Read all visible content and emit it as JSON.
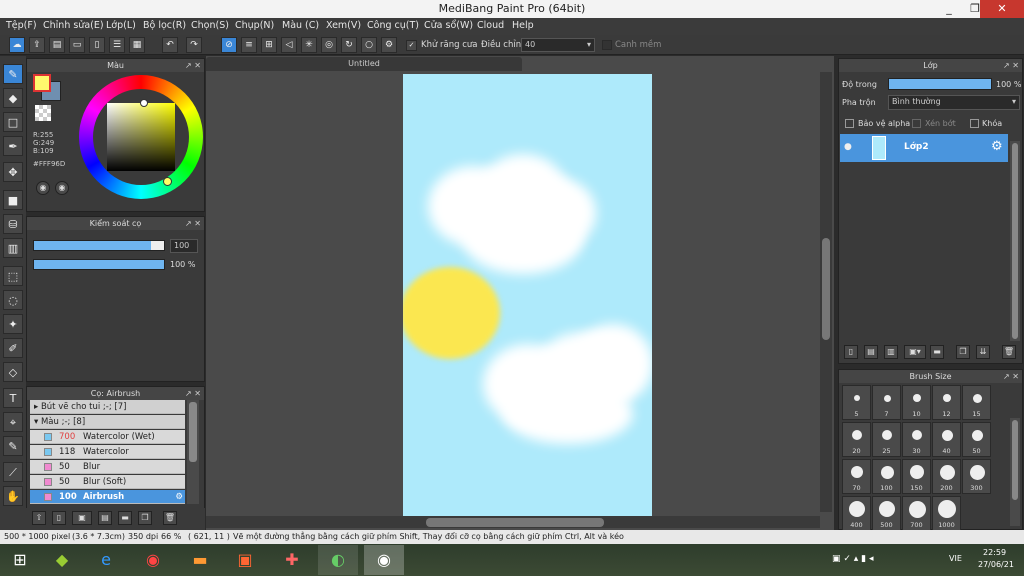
{
  "window": {
    "title": "MediBang Paint Pro (64bit)",
    "min": "_",
    "max": "❐",
    "close": "✕"
  },
  "menu": [
    "Tệp(F)",
    "Chỉnh sửa(E)",
    "Lớp(L)",
    "Bộ lọc(R)",
    "Chọn(S)",
    "Chụp(N)",
    "Màu (C)",
    "Xem(V)",
    "Công cụ(T)",
    "Cửa sổ(W)",
    "Cloud",
    "Help"
  ],
  "toolbar": {
    "antialias_label": "Khử răng cưa",
    "adjust_label": "Điều chỉnh",
    "adjust_value": "40",
    "canvas_label": "Canh mềm"
  },
  "color_panel": {
    "title": "Màu",
    "r": "R:255",
    "g": "G:249",
    "b": "B:109",
    "hex": "#FFF96D",
    "fg": "#FFF96D",
    "bg": "#6f8fb0"
  },
  "brush_control": {
    "title": "Kiểm soát cọ",
    "size": "100",
    "opacity": "100 %",
    "size_fill": 0.9,
    "opacity_fill": 1.0
  },
  "brush_panel": {
    "title": "Cọ: Airbrush",
    "rows": [
      {
        "kind": "group",
        "label": "▸  Bút vẽ cho tui ;-; [7]"
      },
      {
        "kind": "group",
        "label": "▾  Màu ;-; [8]"
      },
      {
        "kind": "item",
        "size": "700",
        "name": "Watercolor (Wet)",
        "color": "#7ac8f0",
        "red": true
      },
      {
        "kind": "item",
        "size": "118",
        "name": "Watercolor",
        "color": "#7ac8f0"
      },
      {
        "kind": "item",
        "size": "50",
        "name": "Blur",
        "color": "#f08ad0"
      },
      {
        "kind": "item",
        "size": "50",
        "name": "Blur (Soft)",
        "color": "#f08ad0"
      },
      {
        "kind": "item",
        "size": "100",
        "name": "Airbrush",
        "color": "#f08ad0",
        "selected": true
      }
    ]
  },
  "document": {
    "tab": "Untitled"
  },
  "layer_panel": {
    "title": "Lớp",
    "opacity_label": "Độ trong",
    "opacity_value": "100 %",
    "blend_label": "Pha trộn",
    "blend_value": "Bình thường",
    "protect_alpha": "Bảo vệ alpha",
    "clip": "Xén bớt",
    "lock": "Khóa",
    "layer_name": "Lớp2"
  },
  "brush_size_panel": {
    "title": "Brush Size",
    "sizes": [
      "5",
      "7",
      "10",
      "12",
      "15",
      "20",
      "25",
      "30",
      "40",
      "50",
      "70",
      "100",
      "150",
      "200",
      "300",
      "400",
      "500",
      "700",
      "1000"
    ]
  },
  "status": {
    "dims": "500 * 1000 pixel",
    "cm": "(3.6 * 7.3cm)",
    "dpi": "350 dpi",
    "zoom": "66 %",
    "coord": "( 621, 11 )",
    "hint": "Vẽ một đường thẳng bằng cách giữ phím Shift, Thay đổi cỡ cọ bằng cách giữ phím Ctrl, Alt và kéo"
  },
  "taskbar": {
    "lang": "VIE",
    "time": "22:59",
    "date": "27/06/21"
  }
}
